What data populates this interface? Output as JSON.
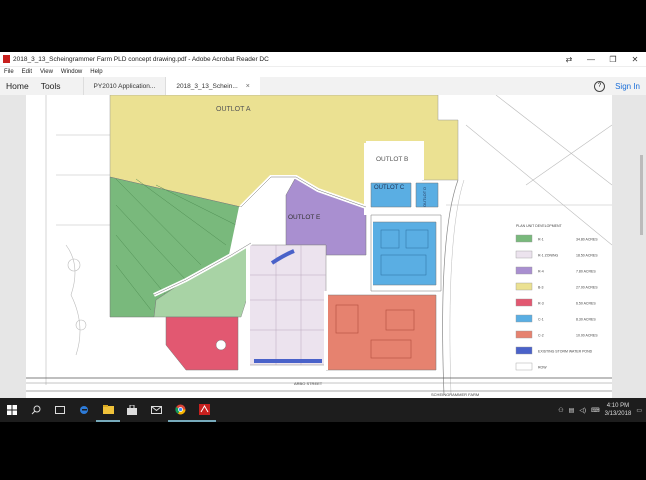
{
  "window": {
    "title": "2018_3_13_Scheingrammer Farm PLD concept drawing.pdf - Adobe Acrobat Reader DC",
    "controls": [
      "⇄",
      "—",
      "❐",
      "✕"
    ]
  },
  "menu": [
    "File",
    "Edit",
    "View",
    "Window",
    "Help"
  ],
  "toolbar": {
    "home": "Home",
    "tools": "Tools",
    "tabs": [
      {
        "label": "PY2010 Application..."
      },
      {
        "label": "2018_3_13_Schein..."
      }
    ],
    "close_glyph": "×",
    "help_glyph": "?",
    "sign_in": "Sign In"
  },
  "map": {
    "outlots": [
      "OUTLOT A",
      "OUTLOT B",
      "OUTLOT C",
      "OUTLOT D",
      "OUTLOT E"
    ],
    "street_label": "ARBO STREET",
    "title_block": "SCHEINGRAMMER FARM",
    "legend": {
      "title": "PLAN UNIT DEVELOPMENT",
      "entries": [
        {
          "label": "R-1",
          "acres": "34.80 ACRES",
          "color": "#79b97c"
        },
        {
          "label": "R-1 ZONING",
          "acres": "18.50 ACRES",
          "color": "#ece3ee"
        },
        {
          "label": "R-4",
          "acres": "7.80 ACRES",
          "color": "#a98fd0"
        },
        {
          "label": "B-3",
          "acres": "27.00 ACRES",
          "color": "#ebe192"
        },
        {
          "label": "R-3",
          "acres": "6.50 ACRES",
          "color": "#e25871"
        },
        {
          "label": "C-1",
          "acres": "8.30 ACRES",
          "color": "#5aaee3"
        },
        {
          "label": "C-2",
          "acres": "10.00 ACRES",
          "color": "#e6826f"
        },
        {
          "label": "EXISTING STORM WATER POND",
          "acres": "",
          "color": "#4a62c9"
        },
        {
          "label": "ROW",
          "acres": "",
          "color": "#ffffff"
        }
      ]
    }
  },
  "taskbar": {
    "icons": [
      "windows-icon",
      "search-icon",
      "task-view-icon",
      "edge-icon",
      "file-explorer-icon",
      "store-icon",
      "mail-icon",
      "chrome-icon",
      "acrobat-icon"
    ],
    "time": "4:10 PM",
    "date": "3/13/2018"
  }
}
